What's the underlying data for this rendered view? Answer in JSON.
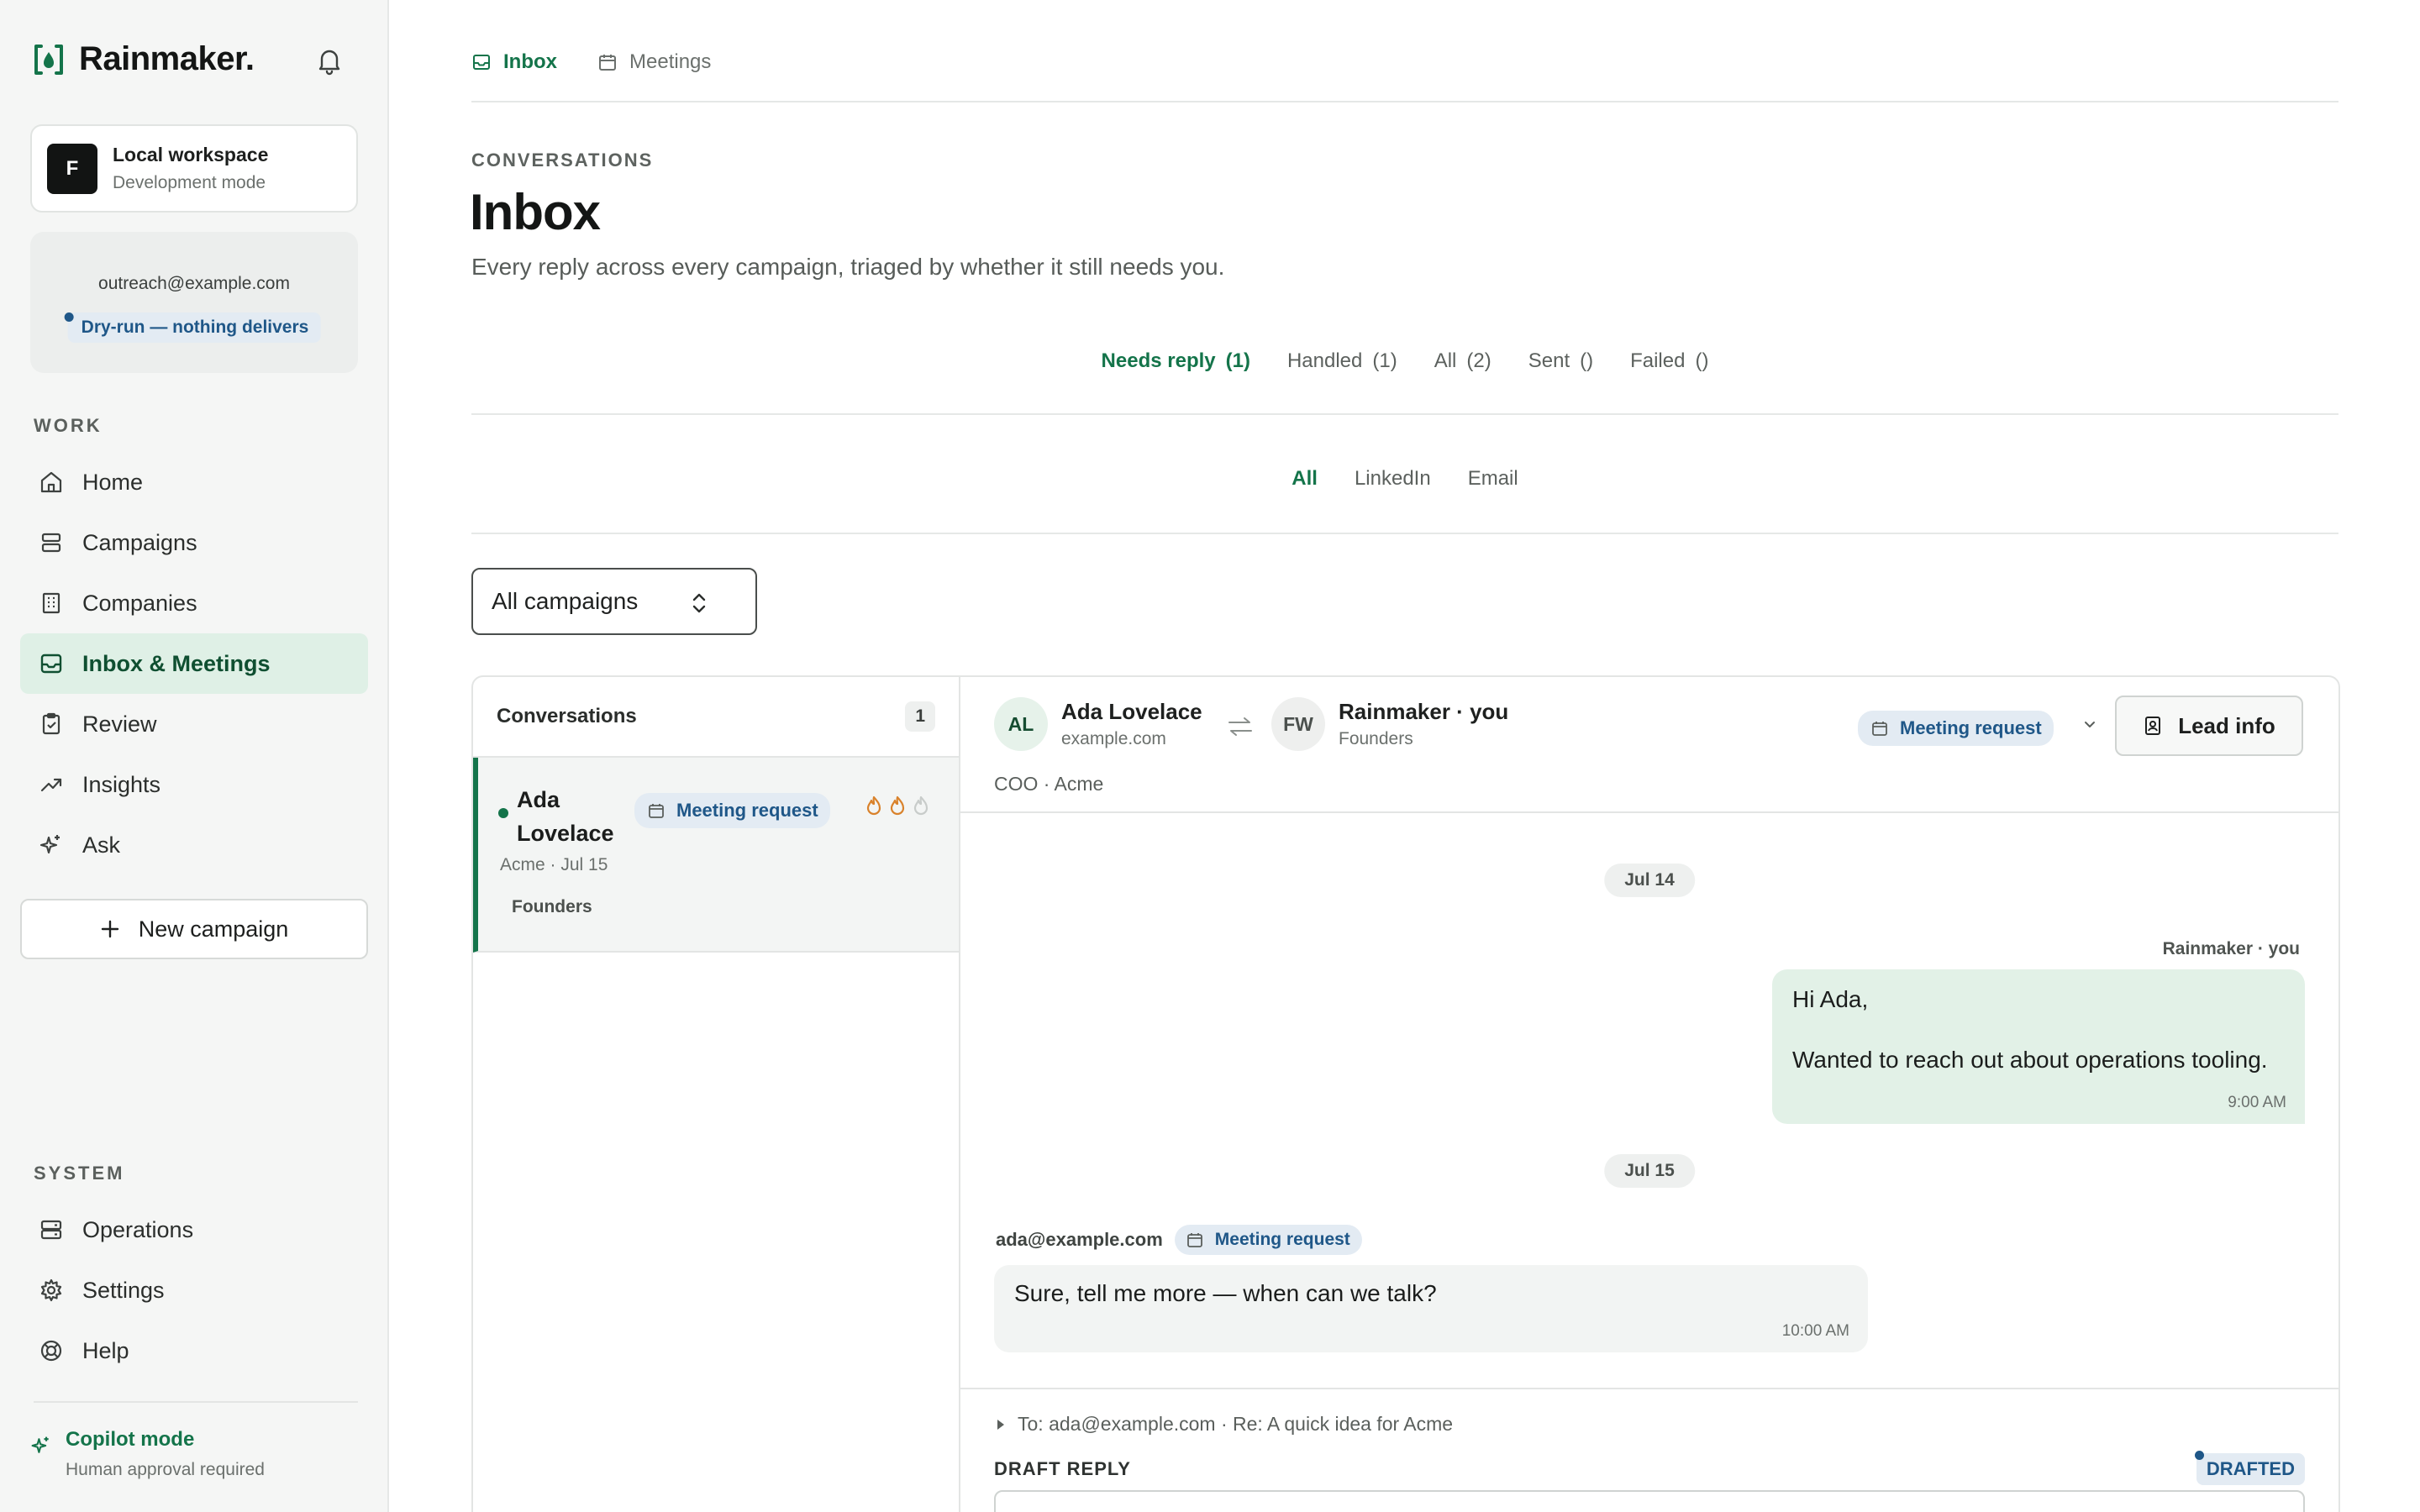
{
  "brand": {
    "name": "Rainmaker."
  },
  "workspace": {
    "initial": "F",
    "title": "Local workspace",
    "subtitle": "Development mode"
  },
  "account": {
    "email": "outreach@example.com",
    "badge": "Dry-run — nothing delivers"
  },
  "sidebar": {
    "work_label": "WORK",
    "work_items": [
      {
        "label": "Home",
        "icon": "home-icon"
      },
      {
        "label": "Campaigns",
        "icon": "campaigns-icon"
      },
      {
        "label": "Companies",
        "icon": "building-icon"
      },
      {
        "label": "Inbox & Meetings",
        "icon": "inbox-icon",
        "active": true
      },
      {
        "label": "Review",
        "icon": "clipboard-icon"
      },
      {
        "label": "Insights",
        "icon": "trend-icon"
      },
      {
        "label": "Ask",
        "icon": "sparkle-icon"
      }
    ],
    "new_campaign": "New campaign",
    "system_label": "SYSTEM",
    "system_items": [
      {
        "label": "Operations",
        "icon": "server-icon"
      },
      {
        "label": "Settings",
        "icon": "gear-icon"
      },
      {
        "label": "Help",
        "icon": "lifebuoy-icon"
      }
    ],
    "copilot": {
      "title": "Copilot mode",
      "subtitle": "Human approval required"
    }
  },
  "top_tabs": [
    {
      "label": "Inbox",
      "active": true
    },
    {
      "label": "Meetings"
    }
  ],
  "header": {
    "eyebrow": "CONVERSATIONS",
    "title": "Inbox",
    "subtitle": "Every reply across every campaign, triaged by whether it still needs you."
  },
  "status_filters": [
    {
      "label": "Needs reply",
      "count": "(1)",
      "active": true
    },
    {
      "label": "Handled",
      "count": "(1)"
    },
    {
      "label": "All",
      "count": "(2)"
    },
    {
      "label": "Sent",
      "count": "()"
    },
    {
      "label": "Failed",
      "count": "()"
    }
  ],
  "channel_filters": [
    {
      "label": "All",
      "active": true
    },
    {
      "label": "LinkedIn"
    },
    {
      "label": "Email"
    }
  ],
  "campaign_select": {
    "value": "All campaigns"
  },
  "conversations": {
    "title": "Conversations",
    "count": "1",
    "items": [
      {
        "name": "Ada Lovelace",
        "tag": "Meeting request",
        "meta": "Acme · Jul 15",
        "group": "Founders"
      }
    ]
  },
  "thread": {
    "lead": {
      "initials": "AL",
      "name": "Ada Lovelace",
      "domain": "example.com",
      "role": "COO · Acme"
    },
    "sender": {
      "initials": "FW",
      "name": "Rainmaker · you",
      "team": "Founders"
    },
    "status_pill": "Meeting request",
    "lead_info_button": "Lead info",
    "messages": [
      {
        "date": "Jul 14",
        "from": "Rainmaker · you",
        "line1": "Hi Ada,",
        "line2": "Wanted to reach out about operations tooling.",
        "time": "9:00 AM"
      },
      {
        "date": "Jul 15",
        "from": "ada@example.com",
        "tag": "Meeting request",
        "text": "Sure, tell me more — when can we talk?",
        "time": "10:00 AM"
      }
    ],
    "compose": {
      "to_line": "To: ada@example.com · Re: A quick idea for Acme",
      "draft_label": "DRAFT REPLY",
      "status": "DRAFTED"
    }
  },
  "colors": {
    "accent": "#14744a",
    "active_bg": "#dff0e6",
    "pill_bg": "#e3ebf3",
    "pill_text": "#1f5788",
    "flame": "#d9822b"
  }
}
